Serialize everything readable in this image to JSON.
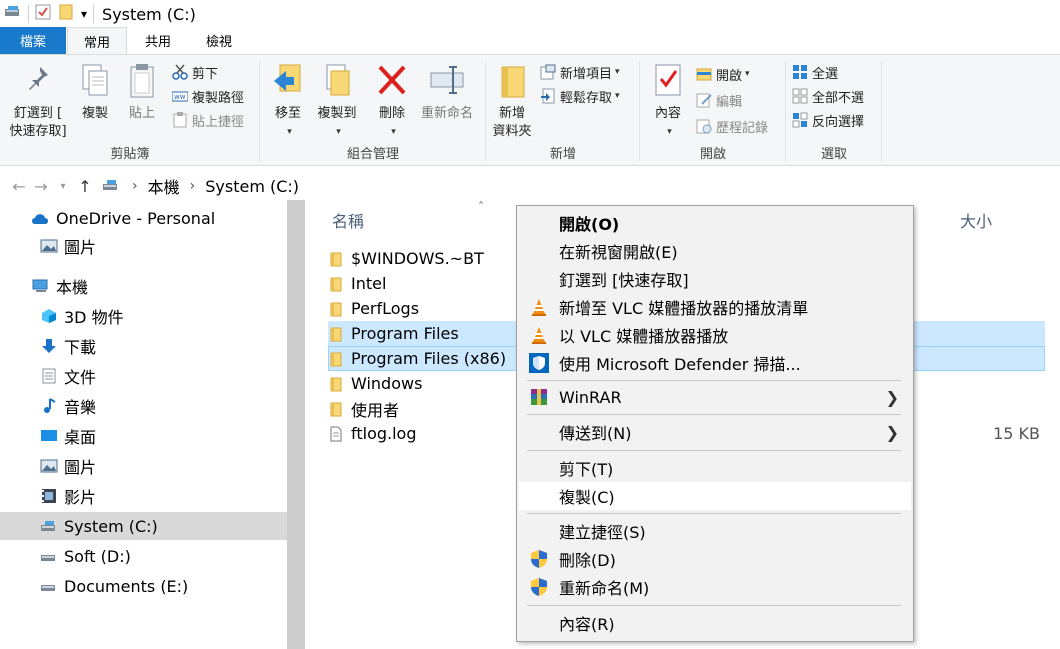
{
  "window": {
    "title": "System (C:)"
  },
  "ribbon_tabs": [
    "檔案",
    "常用",
    "共用",
    "檢視"
  ],
  "ribbon": {
    "clipboard": {
      "label": "剪貼簿",
      "pin_line1": "釘選到 [",
      "pin_line2": "快速存取]",
      "copy": "複製",
      "paste": "貼上",
      "cut": "剪下",
      "copy_path": "複製路徑",
      "paste_shortcut": "貼上捷徑"
    },
    "organize": {
      "label": "組合管理",
      "move_to": "移至",
      "copy_to": "複製到",
      "delete": "刪除",
      "rename": "重新命名"
    },
    "new": {
      "label": "新增",
      "new_folder_line1": "新增",
      "new_folder_line2": "資料夾",
      "new_item": "新增項目",
      "easy_access": "輕鬆存取"
    },
    "open": {
      "label": "開啟",
      "properties": "內容",
      "open": "開啟",
      "edit": "編輯",
      "history": "歷程記錄"
    },
    "select": {
      "label": "選取",
      "select_all": "全選",
      "select_none": "全部不選",
      "invert": "反向選擇"
    }
  },
  "address": {
    "this_pc": "本機",
    "current": "System (C:)"
  },
  "nav_pane": {
    "items": [
      {
        "label": "OneDrive - Personal",
        "icon": "cloud-icon"
      },
      {
        "label": "圖片",
        "icon": "pictures-icon"
      },
      {
        "label": "本機",
        "icon": "computer-icon"
      },
      {
        "label": "3D 物件",
        "icon": "3d-objects-icon"
      },
      {
        "label": "下載",
        "icon": "download-icon"
      },
      {
        "label": "文件",
        "icon": "documents-icon"
      },
      {
        "label": "音樂",
        "icon": "music-icon"
      },
      {
        "label": "桌面",
        "icon": "desktop-icon"
      },
      {
        "label": "圖片",
        "icon": "pictures-icon"
      },
      {
        "label": "影片",
        "icon": "video-icon"
      },
      {
        "label": "System (C:)",
        "icon": "drive-icon"
      },
      {
        "label": "Soft (D:)",
        "icon": "drive-icon"
      },
      {
        "label": "Documents (E:)",
        "icon": "drive-icon"
      }
    ]
  },
  "file_list": {
    "columns": {
      "name": "名稱",
      "size": "大小"
    },
    "items": [
      {
        "name": "$WINDOWS.~BT",
        "size": ""
      },
      {
        "name": "Intel",
        "size": ""
      },
      {
        "name": "PerfLogs",
        "size": ""
      },
      {
        "name": "Program Files",
        "size": ""
      },
      {
        "name": "Program Files (x86)",
        "size": ""
      },
      {
        "name": "Windows",
        "size": ""
      },
      {
        "name": "使用者",
        "size": ""
      },
      {
        "name": "ftlog.log",
        "size": "15 KB"
      }
    ]
  },
  "context_menu": {
    "items": [
      {
        "label": "開啟(O)"
      },
      {
        "label": "在新視窗開啟(E)"
      },
      {
        "label": "釘選到 [快速存取]"
      },
      {
        "label": "新增至 VLC 媒體播放器的播放清單"
      },
      {
        "label": "以 VLC 媒體播放器播放"
      },
      {
        "label": "使用 Microsoft Defender 掃描..."
      },
      {
        "label": "WinRAR"
      },
      {
        "label": "傳送到(N)"
      },
      {
        "label": "剪下(T)"
      },
      {
        "label": "複製(C)"
      },
      {
        "label": "建立捷徑(S)"
      },
      {
        "label": "刪除(D)"
      },
      {
        "label": "重新命名(M)"
      },
      {
        "label": "內容(R)"
      }
    ]
  },
  "colors": {
    "file_tab": "#1979ca",
    "selection": "#cce8ff",
    "folder": "#f8d775",
    "accent": "#0078d7"
  }
}
